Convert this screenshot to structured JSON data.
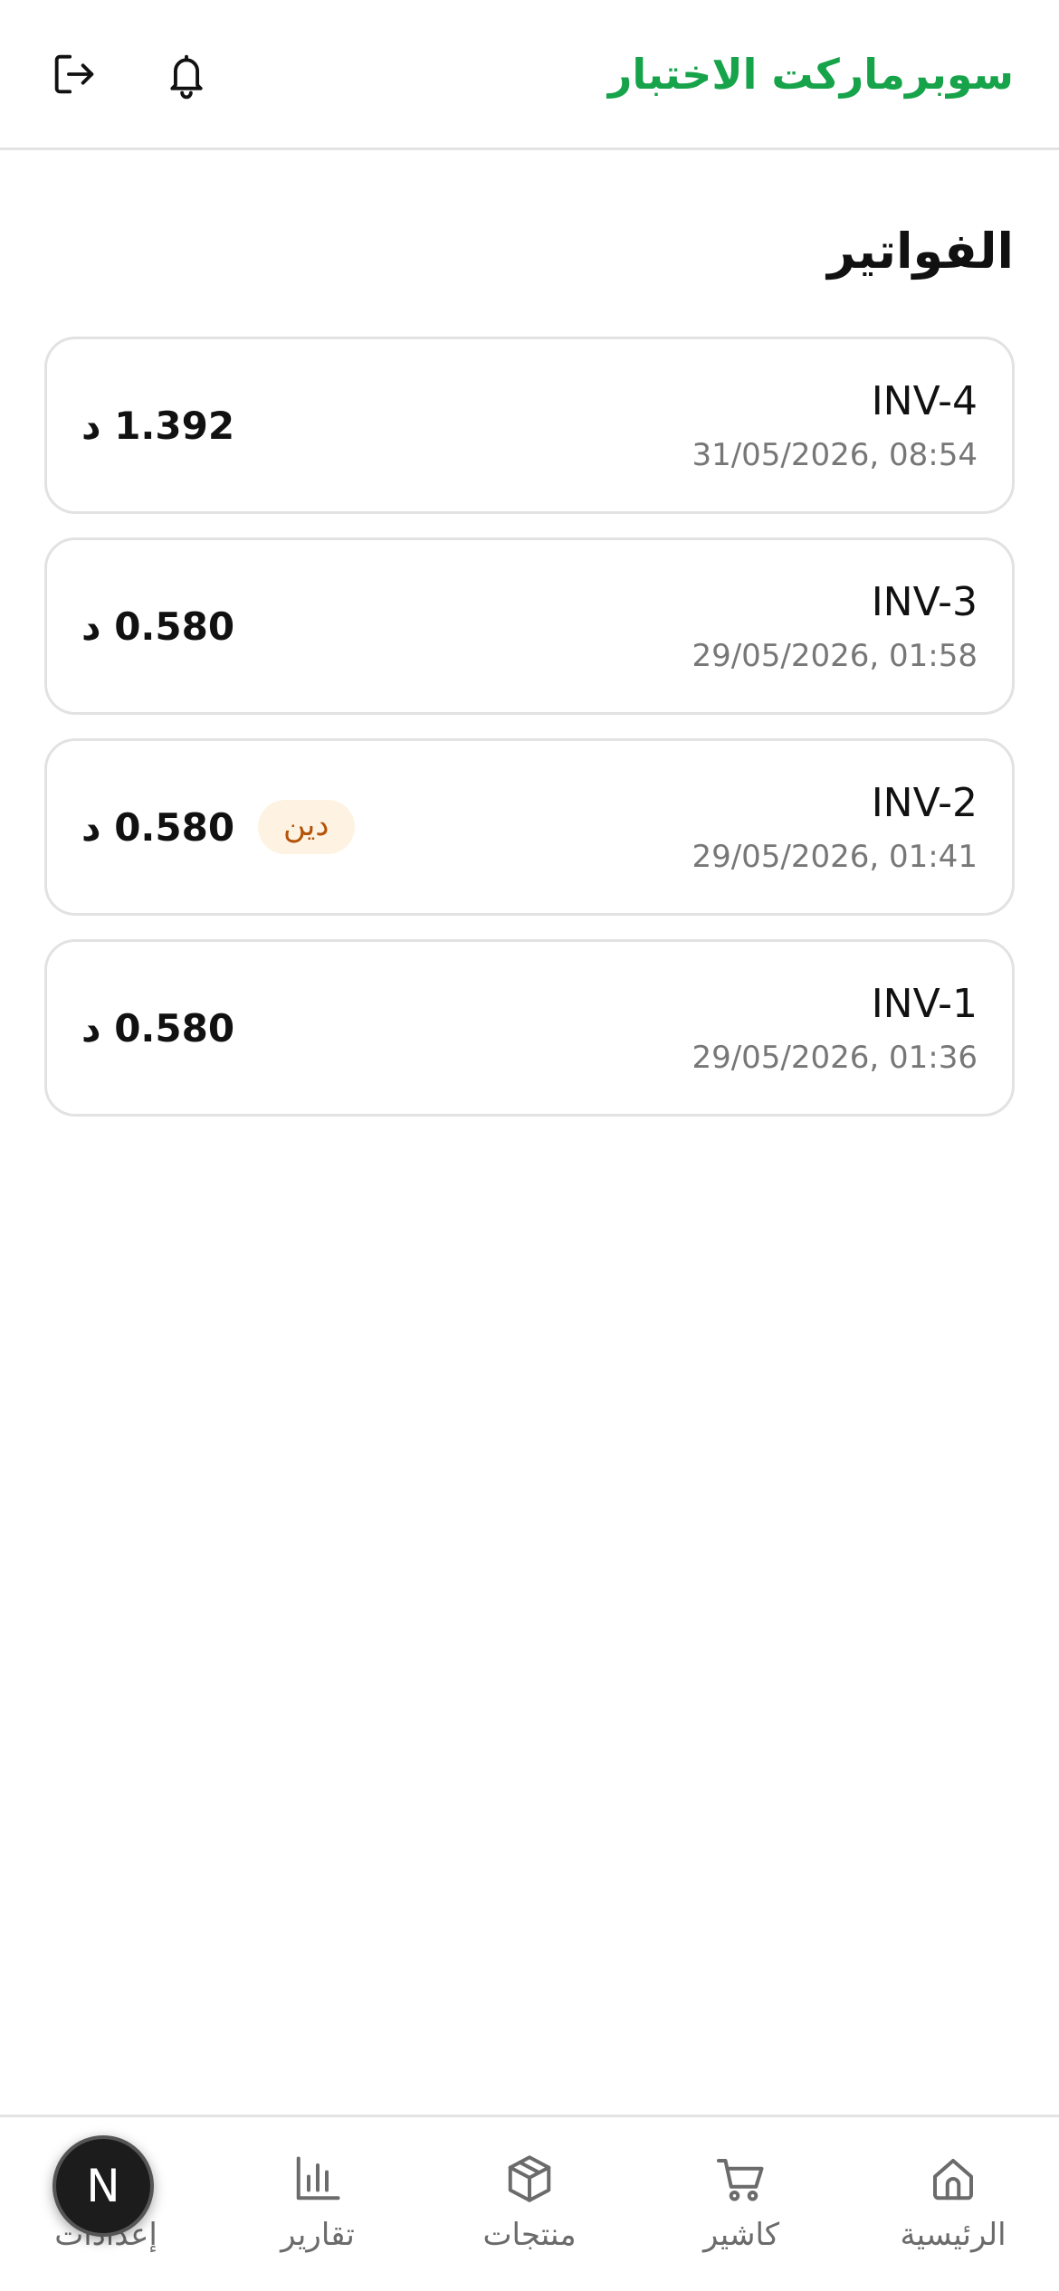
{
  "header": {
    "app_title": "سوبرماركت الاختبار"
  },
  "page": {
    "title": "الفواتير"
  },
  "invoices": [
    {
      "id": "INV-4",
      "date": "31/05/2026, 08:54",
      "amount": "1.392 د",
      "badge": ""
    },
    {
      "id": "INV-3",
      "date": "29/05/2026, 01:58",
      "amount": "0.580 د",
      "badge": ""
    },
    {
      "id": "INV-2",
      "date": "29/05/2026, 01:41",
      "amount": "0.580 د",
      "badge": "دين"
    },
    {
      "id": "INV-1",
      "date": "29/05/2026, 01:36",
      "amount": "0.580 د",
      "badge": ""
    }
  ],
  "bottom_nav": {
    "items": [
      {
        "label": "الرئيسية",
        "icon": "home-icon"
      },
      {
        "label": "كاشير",
        "icon": "cart-icon"
      },
      {
        "label": "منتجات",
        "icon": "box-icon"
      },
      {
        "label": "تقارير",
        "icon": "bar-chart-icon"
      },
      {
        "label": "إعدادات",
        "icon": "gear-icon"
      }
    ]
  },
  "floating_badge": {
    "text": "N"
  },
  "colors": {
    "brand": "#16a34a",
    "debt_badge_bg": "#fef3e2",
    "debt_badge_text": "#b45309"
  }
}
